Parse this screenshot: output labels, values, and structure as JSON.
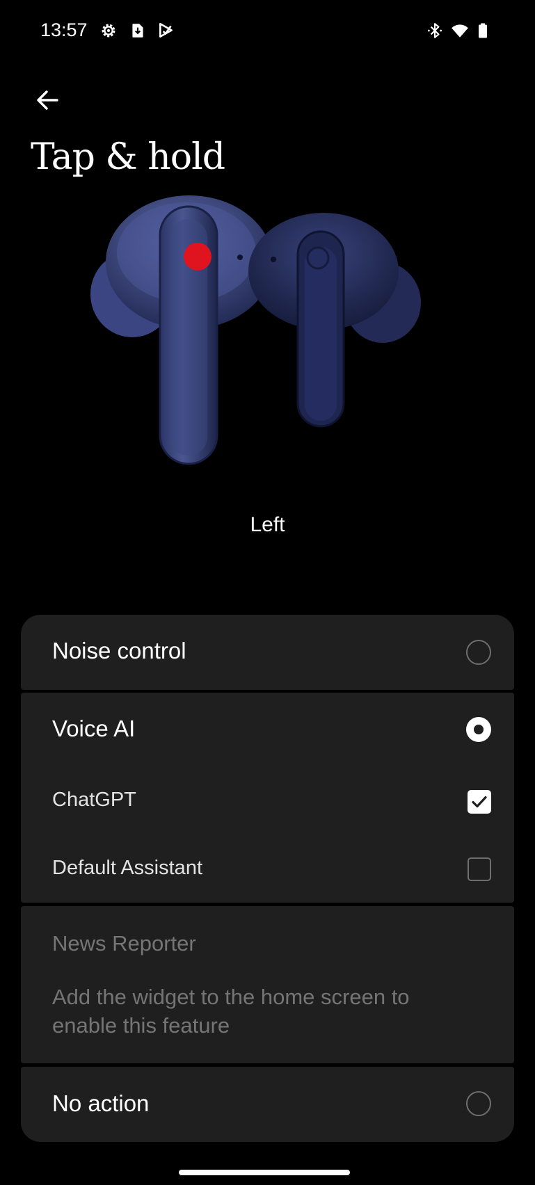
{
  "status_bar": {
    "time": "13:57",
    "icons_left": [
      "settings-icon",
      "download-icon",
      "play-store-icon"
    ],
    "icons_right": [
      "bluetooth-icon",
      "wifi-icon",
      "battery-icon"
    ]
  },
  "header": {
    "back_icon": "arrow-left-icon",
    "title": "Tap & hold"
  },
  "hero": {
    "image": "earbuds-image",
    "highlight_color": "#e0141e",
    "side_label": "Left"
  },
  "options": {
    "noise_control": {
      "label": "Noise control",
      "selected": false
    },
    "voice_ai": {
      "label": "Voice AI",
      "selected": true,
      "sub_options": [
        {
          "label": "ChatGPT",
          "checked": true
        },
        {
          "label": "Default Assistant",
          "checked": false
        }
      ]
    },
    "news_reporter": {
      "label": "News Reporter",
      "description": "Add the widget to the home screen to enable this feature",
      "enabled": false
    },
    "no_action": {
      "label": "No action",
      "selected": false
    }
  },
  "colors": {
    "background": "#000000",
    "card": "#1f1f1f",
    "text": "#ffffff",
    "disabled_text": "#757575"
  }
}
